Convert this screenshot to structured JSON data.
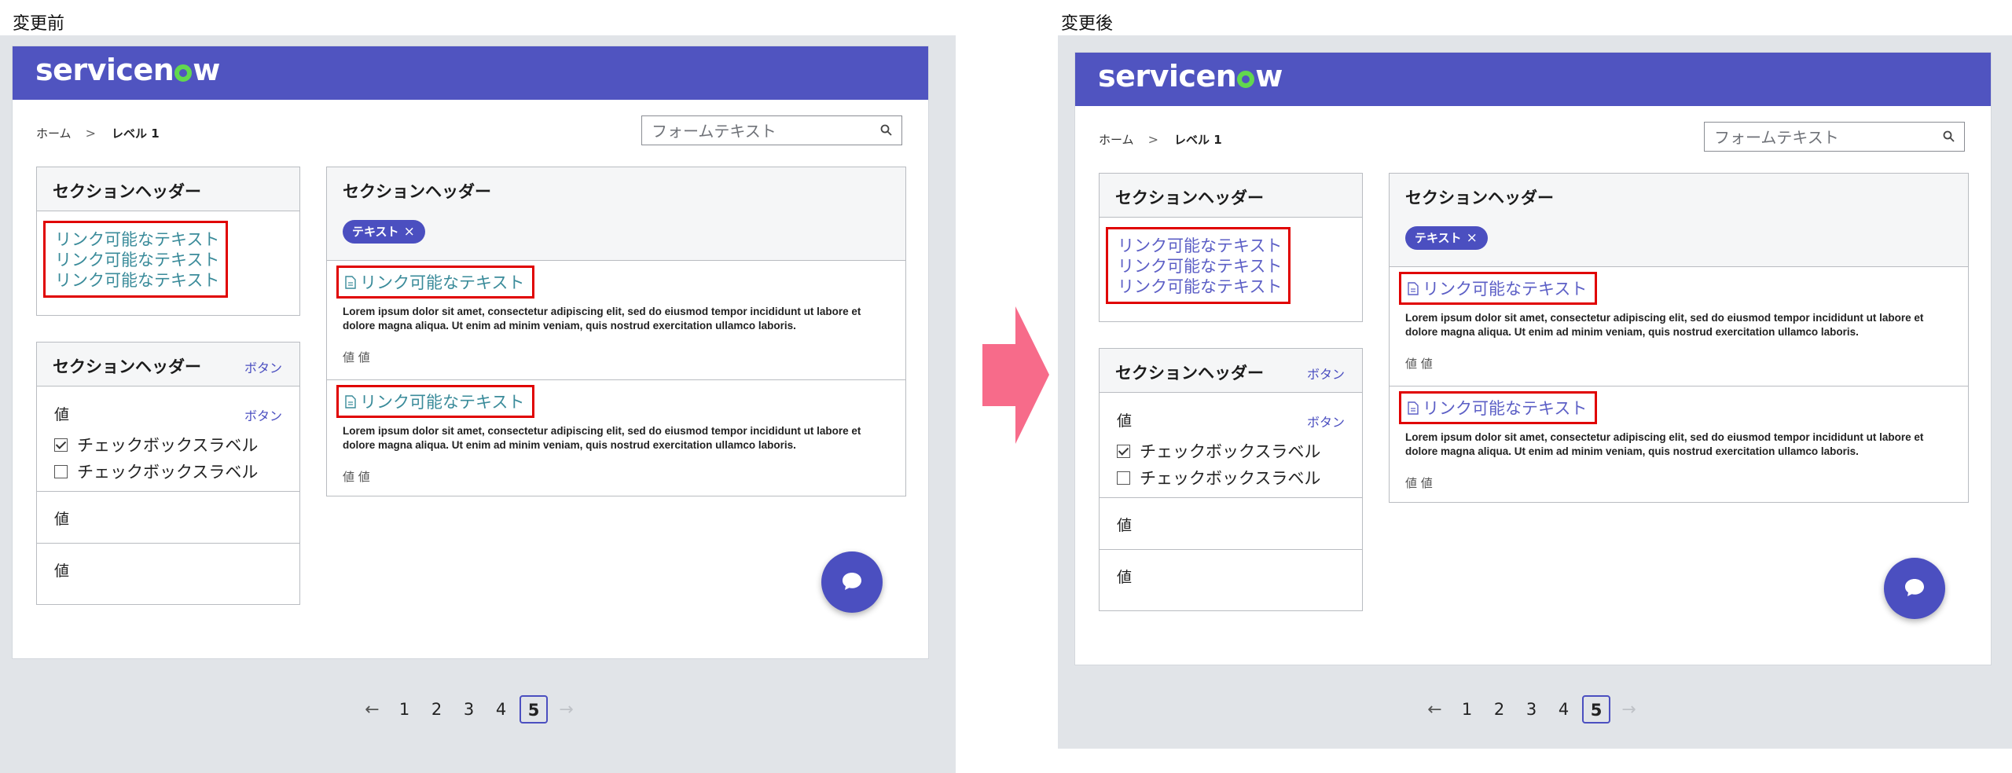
{
  "labels": {
    "before": "変更前",
    "after": "変更後"
  },
  "logo": {
    "text_before_o": "servicen",
    "text_after_o": "w"
  },
  "breadcrumb": {
    "home": "ホーム",
    "separator": ">",
    "current": "レベル 1"
  },
  "search": {
    "placeholder": "フォームテキスト"
  },
  "left_section_1": {
    "header": "セクションヘッダー",
    "links": [
      "リンク可能なテキスト",
      "リンク可能なテキスト",
      "リンク可能なテキスト"
    ]
  },
  "left_section_2": {
    "header": "セクションヘッダー",
    "header_button": "ボタン",
    "value_label": "値",
    "value_button": "ボタン",
    "checkboxes": [
      {
        "label": "チェックボックスラベル",
        "checked": true
      },
      {
        "label": "チェックボックスラベル",
        "checked": false
      }
    ],
    "rows": [
      "値",
      "値"
    ]
  },
  "right_section": {
    "header": "セクションヘッダー",
    "chip": "テキスト",
    "chip_remove": "×",
    "items": [
      {
        "link": "リンク可能なテキスト",
        "body": "Lorem ipsum dolor sit amet, consectetur adipiscing elit, sed do eiusmod tempor incididunt ut labore et dolore magna aliqua. Ut enim ad minim veniam, quis nostrud exercitation ullamco laboris.",
        "value": "値 値"
      },
      {
        "link": "リンク可能なテキスト",
        "body": "Lorem ipsum dolor sit amet, consectetur adipiscing elit, sed do eiusmod tempor incididunt ut labore et dolore magna aliqua. Ut enim ad minim veniam, quis nostrud exercitation ullamco laboris.",
        "value": "値 値"
      }
    ]
  },
  "pagination": {
    "prev": "←",
    "pages": [
      "1",
      "2",
      "3",
      "4"
    ],
    "current": "5",
    "next": "→"
  },
  "colors": {
    "brand_bar": "#5054c0",
    "accent": "#4b4fc0",
    "logo_green": "#62d84e",
    "link_before": "#3a8b9a",
    "link_after": "#5c5fc6",
    "highlight": "#e00000",
    "arrow": "#f76b8a"
  },
  "icons": [
    "search-icon",
    "document-icon",
    "chat-icon",
    "arrow-right-icon"
  ]
}
